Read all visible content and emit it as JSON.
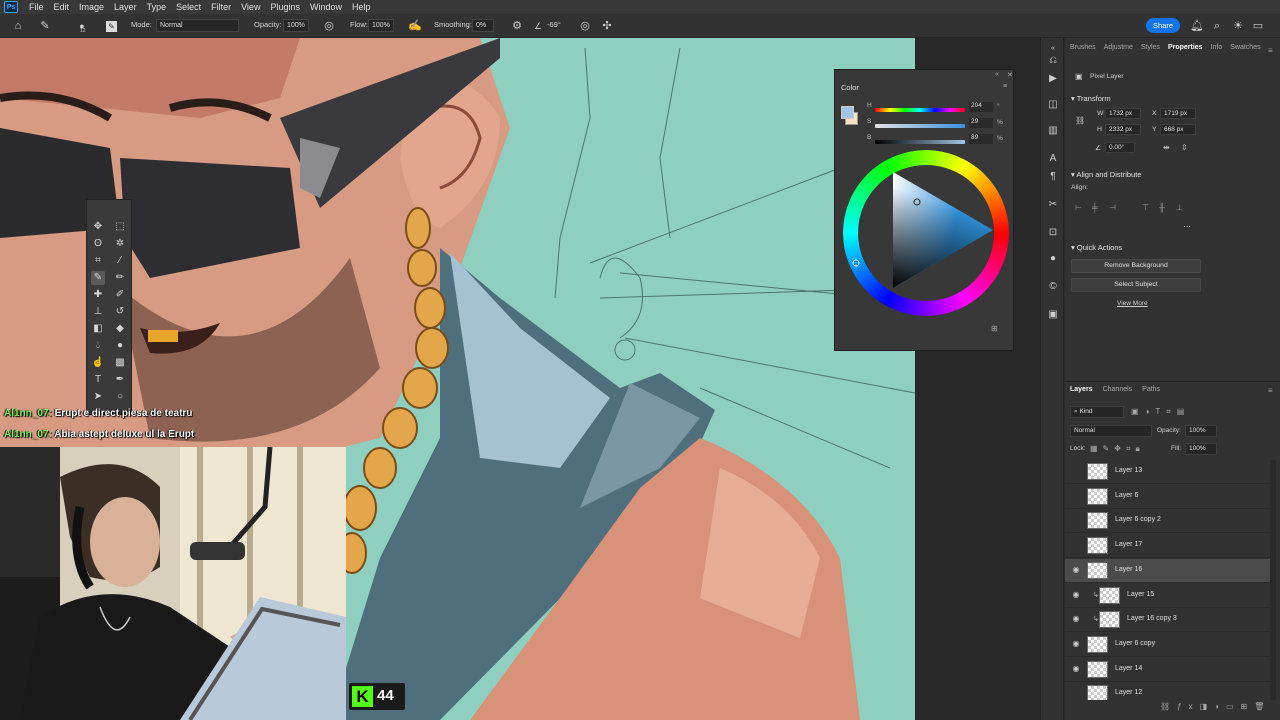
{
  "app": {
    "name": "Photoshop",
    "logo_text": "Ps"
  },
  "menu": [
    "File",
    "Edit",
    "Image",
    "Layer",
    "Type",
    "Select",
    "Filter",
    "View",
    "Plugins",
    "Window",
    "Help"
  ],
  "options_bar": {
    "brush_size": "12",
    "mode_label": "Mode:",
    "mode_value": "Normal",
    "opacity_label": "Opacity:",
    "opacity_value": "100%",
    "flow_label": "Flow:",
    "flow_value": "100%",
    "smoothing_label": "Smoothing:",
    "smoothing_value": "0%",
    "angle_value": "-69°",
    "share_label": "Share"
  },
  "color_panel": {
    "title": "Color",
    "h": {
      "label": "H",
      "value": "204",
      "unit": "°"
    },
    "s": {
      "label": "S",
      "value": "29",
      "unit": "%"
    },
    "b": {
      "label": "B",
      "value": "89",
      "unit": "%"
    },
    "foreground_color": "#a2c6e3",
    "background_color": "#f4e2c0"
  },
  "properties": {
    "tabs": [
      "Brushes",
      "Adjustme",
      "Styles",
      "Properties",
      "Info",
      "Swatches"
    ],
    "active_tab": "Properties",
    "layer_type": "Pixel Layer",
    "transform_title": "Transform",
    "w_label": "W",
    "w_value": "1732 px",
    "x_label": "X",
    "x_value": "1719 px",
    "h_label": "H",
    "h_value": "2332 px",
    "y_label": "Y",
    "y_value": "668 px",
    "angle_value": "0.00°",
    "align_title": "Align and Distribute",
    "align_label": "Align:",
    "quick_actions_title": "Quick Actions",
    "remove_bg": "Remove Background",
    "select_subject": "Select Subject",
    "view_more": "View More"
  },
  "layers_panel": {
    "tabs": [
      "Layers",
      "Channels",
      "Paths"
    ],
    "kind_label": "Kind",
    "blend_mode": "Normal",
    "opacity_label": "Opacity:",
    "opacity_value": "100%",
    "lock_label": "Lock:",
    "fill_label": "Fill:",
    "fill_value": "100%",
    "layers": [
      {
        "name": "Layer 13",
        "visible": false,
        "clipped": false,
        "selected": false
      },
      {
        "name": "Layer 6",
        "visible": false,
        "clipped": false,
        "selected": false
      },
      {
        "name": "Layer 6 copy 2",
        "visible": false,
        "clipped": false,
        "selected": false
      },
      {
        "name": "Layer 17",
        "visible": false,
        "clipped": false,
        "selected": false
      },
      {
        "name": "Layer 16",
        "visible": true,
        "clipped": false,
        "selected": true
      },
      {
        "name": "Layer 15",
        "visible": true,
        "clipped": true,
        "selected": false
      },
      {
        "name": "Layer 16 copy 3",
        "visible": true,
        "clipped": true,
        "selected": false
      },
      {
        "name": "Layer 6 copy",
        "visible": true,
        "clipped": false,
        "selected": false
      },
      {
        "name": "Layer 14",
        "visible": true,
        "clipped": false,
        "selected": false
      },
      {
        "name": "Layer 12",
        "visible": false,
        "clipped": false,
        "selected": false
      }
    ]
  },
  "chat": [
    {
      "user": "Al1nn_07:",
      "message": "Erupt e direct piesa de teatru"
    },
    {
      "user": "Al1nn_07:",
      "message": "Abia astept deluxe ul la Erupt"
    }
  ],
  "kick": {
    "logo": "K",
    "viewers": "44"
  }
}
